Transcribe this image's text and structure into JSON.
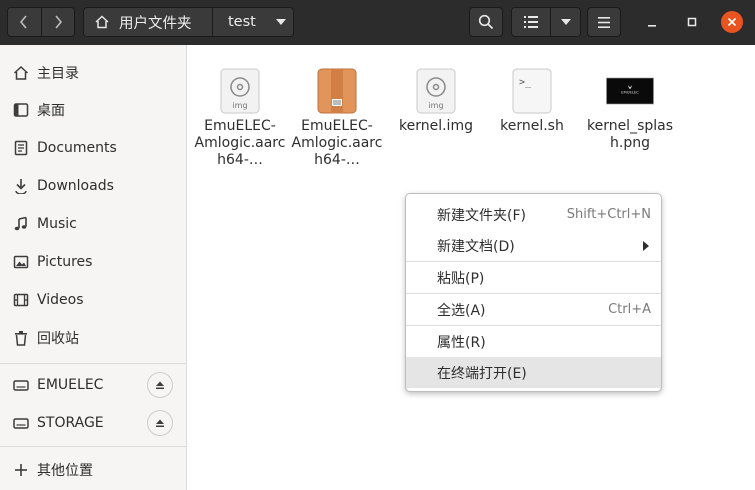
{
  "header": {
    "path_home": "用户文件夹",
    "path_current": "test",
    "close_color": "#e95420"
  },
  "sidebar": {
    "items": [
      {
        "label": "主目录",
        "icon": "home-icon"
      },
      {
        "label": "桌面",
        "icon": "desktop-icon"
      },
      {
        "label": "Documents",
        "icon": "documents-icon"
      },
      {
        "label": "Downloads",
        "icon": "downloads-icon"
      },
      {
        "label": "Music",
        "icon": "music-icon"
      },
      {
        "label": "Pictures",
        "icon": "pictures-icon"
      },
      {
        "label": "Videos",
        "icon": "videos-icon"
      },
      {
        "label": "回收站",
        "icon": "trash-icon"
      }
    ],
    "devices": [
      {
        "label": "EMUELEC",
        "icon": "drive-icon"
      },
      {
        "label": "STORAGE",
        "icon": "drive-icon"
      }
    ],
    "other_locations": "其他位置"
  },
  "files": [
    {
      "name": "EmuELEC-Amlogic.aarch64-…",
      "icon": "disc-image-icon",
      "icon_text": "img"
    },
    {
      "name": "EmuELEC-Amlogic.aarch64-…",
      "icon": "archive-icon",
      "icon_text": ""
    },
    {
      "name": "kernel.img",
      "icon": "disc-image-icon",
      "icon_text": "img"
    },
    {
      "name": "kernel.sh",
      "icon": "script-icon",
      "icon_text": ">_"
    },
    {
      "name": "kernel_splash.png",
      "icon": "image-thumbnail-icon",
      "icon_text": "EMUELEC"
    }
  ],
  "context_menu": {
    "items": [
      {
        "label": "新建文件夹(F)",
        "accel": "Shift+Ctrl+N"
      },
      {
        "label": "新建文档(D)",
        "accel": ""
      },
      {
        "label": "粘贴(P)",
        "accel": ""
      },
      {
        "label": "全选(A)",
        "accel": "Ctrl+A"
      },
      {
        "label": "属性(R)",
        "accel": ""
      },
      {
        "label": "在终端打开(E)",
        "accel": ""
      }
    ]
  }
}
